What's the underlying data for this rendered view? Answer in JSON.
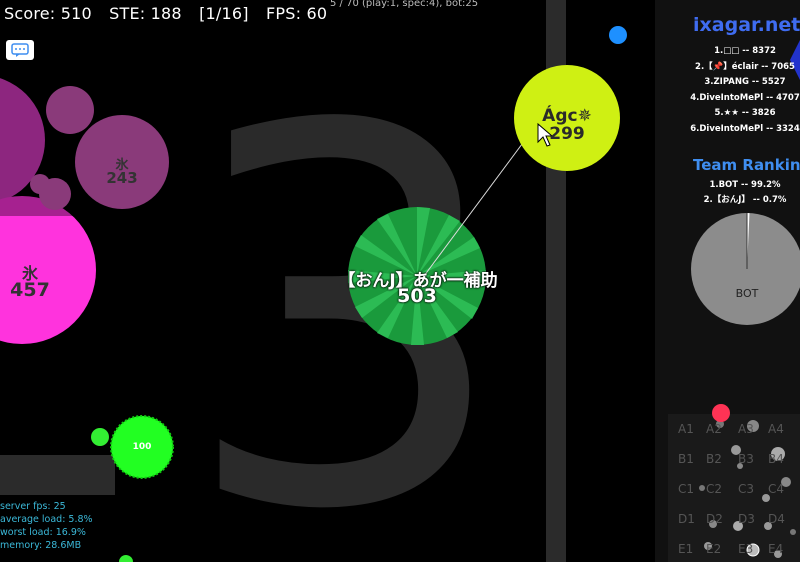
{
  "hud": {
    "score": "Score: 510",
    "ste": "STE: 188",
    "page": "[1/16]",
    "fps": "FPS: 60",
    "players_line": "5 / 70 (play:1, spec:4), bot:25"
  },
  "server": {
    "fps": "server fps: 25",
    "avg": "average load: 5.8%",
    "worst": "worst load: 16.9%",
    "memory": "memory: 28.6MB"
  },
  "leaderboard": {
    "brand": "ixagar.net",
    "entries": [
      "1.□□ -- 8372",
      "2.【📌】éclair -- 7065",
      "3.ZIPANG -- 5527",
      "4.DiveIntoMePl -- 4707",
      "5.★★ -- 3826",
      "6.DiveIntoMePl -- 3324"
    ]
  },
  "team": {
    "title": "Team Ranking",
    "entries": [
      "1.BOT -- 99.2%",
      "2.【おんJ】 -- 0.7%"
    ],
    "pie_label": "BOT",
    "pie_share_bot": 0.992
  },
  "cells": {
    "player_name": "【おんJ】あが一補助",
    "player_mass": "503",
    "yellow_name": "Ágc✵",
    "yellow_mass": "299",
    "pink_name": "氷",
    "pink_mass": "457",
    "purple_name": "氷",
    "purple_mass": "243",
    "virus_mass": "100"
  },
  "background_digit": "3",
  "minimap": {
    "rows": [
      [
        "A1",
        "A2",
        "A3",
        "A4"
      ],
      [
        "B1",
        "B2",
        "B3",
        "B4"
      ],
      [
        "C1",
        "C2",
        "C3",
        "C4"
      ],
      [
        "D1",
        "D2",
        "D3",
        "D4"
      ],
      [
        "E1",
        "E2",
        "E3",
        "E4"
      ]
    ]
  },
  "colors": {
    "player": "#1a9a3c",
    "player_stripe": "#2fbf57",
    "yellow": "#cff013",
    "pink": "#ff33dd",
    "purple": "#8a3a7a",
    "virus": "#22ff22",
    "accent_blue": "#3f6cf0"
  }
}
